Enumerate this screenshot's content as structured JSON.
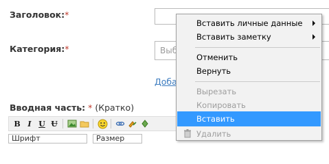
{
  "form": {
    "title_label": "Заголовок:",
    "category_label": "Категория:",
    "required_mark": "*",
    "category_placeholder": "Выб",
    "add_link": "Доба",
    "intro_label": "Вводная часть:",
    "intro_hint": "(Кратко)",
    "font_select": "Шрифт",
    "size_select": "Размер"
  },
  "toolbar": {
    "bold": "B",
    "italic": "I",
    "underline": "U",
    "strike": "Ʉ",
    "icons": [
      "image-icon",
      "folder-icon",
      "smiley-icon",
      "link-icon",
      "unlink-icon",
      "anchor-icon"
    ]
  },
  "context_menu": {
    "items": [
      {
        "label": "Вставить личные данные",
        "enabled": true,
        "submenu": true
      },
      {
        "label": "Вставить заметку",
        "enabled": true,
        "submenu": true
      },
      {
        "label": "Отменить",
        "enabled": true
      },
      {
        "label": "Вернуть",
        "enabled": true
      },
      {
        "label": "Вырезать",
        "enabled": false
      },
      {
        "label": "Копировать",
        "enabled": false
      },
      {
        "label": "Вставить",
        "enabled": true,
        "highlighted": true
      },
      {
        "label": "Удалить",
        "enabled": false
      }
    ],
    "highlight_color": "#3399ff"
  }
}
